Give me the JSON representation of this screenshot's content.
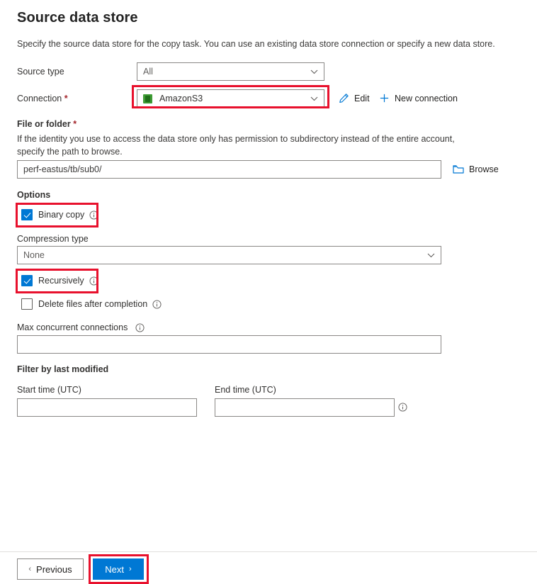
{
  "header": {
    "title": "Source data store",
    "description": "Specify the source data store for the copy task. You can use an existing data store connection or specify a new data store."
  },
  "form": {
    "source_type": {
      "label": "Source type",
      "value": "All",
      "chevron_icon": "chevron-down-icon"
    },
    "connection": {
      "label": "Connection",
      "required_marker": "*",
      "value": "AmazonS3",
      "icon": "amazon-s3-icon",
      "chevron_icon": "chevron-down-icon",
      "edit_label": "Edit",
      "edit_icon": "pencil-icon",
      "new_connection_label": "New connection",
      "new_connection_icon": "plus-icon"
    },
    "file_or_folder": {
      "label": "File or folder",
      "required_marker": "*",
      "helper": "If the identity you use to access the data store only has permission to subdirectory instead of the entire account, specify the path to browse.",
      "value": "perf-eastus/tb/sub0/",
      "browse_label": "Browse",
      "browse_icon": "folder-icon"
    },
    "options": {
      "label": "Options",
      "binary_copy": {
        "label": "Binary copy",
        "checked": true,
        "info_icon": "info-icon"
      },
      "compression_type": {
        "label": "Compression type",
        "value": "None",
        "chevron_icon": "chevron-down-icon"
      },
      "recursively": {
        "label": "Recursively",
        "checked": true,
        "info_icon": "info-icon"
      },
      "delete_files_after_completion": {
        "label": "Delete files after completion",
        "checked": false,
        "info_icon": "info-icon"
      },
      "max_concurrent_connections": {
        "label": "Max concurrent connections",
        "value": "",
        "info_icon": "info-icon"
      }
    },
    "filter_by_last_modified": {
      "label": "Filter by last modified",
      "start_time": {
        "label": "Start time (UTC)",
        "value": ""
      },
      "end_time": {
        "label": "End time (UTC)",
        "value": "",
        "info_icon": "info-icon"
      }
    }
  },
  "footer": {
    "previous_label": "Previous",
    "previous_arrow": "‹",
    "next_label": "Next",
    "next_arrow": "›"
  },
  "annotations": {
    "highlight_color": "#e8112d",
    "targets": [
      "connection-dropdown",
      "binary-copy-checkbox",
      "recursively-checkbox",
      "next-button"
    ]
  },
  "colors": {
    "accent": "#0078d4",
    "required": "#a4262c",
    "highlight": "#e8112d",
    "s3_green": "#3f9c35"
  }
}
